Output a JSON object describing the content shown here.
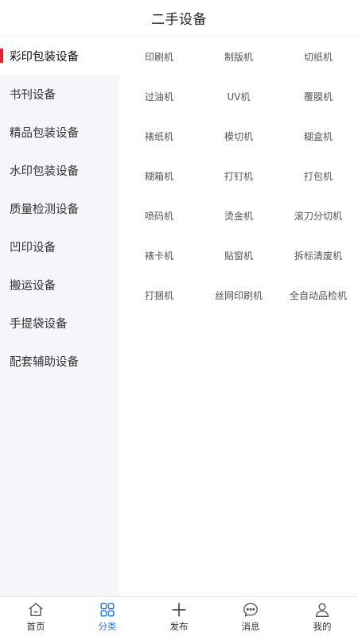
{
  "header": {
    "title": "二手设备"
  },
  "sidebar": {
    "active_index": 0,
    "items": [
      {
        "label": "彩印包装设备"
      },
      {
        "label": "书刊设备"
      },
      {
        "label": "精品包装设备"
      },
      {
        "label": "水印包装设备"
      },
      {
        "label": "质量检测设备"
      },
      {
        "label": "凹印设备"
      },
      {
        "label": "搬运设备"
      },
      {
        "label": "手提袋设备"
      },
      {
        "label": "配套辅助设备"
      }
    ]
  },
  "grid": {
    "items": [
      "印刷机",
      "制版机",
      "切纸机",
      "过油机",
      "UV机",
      "覆膜机",
      "裱纸机",
      "模切机",
      "糊盒机",
      "糊箱机",
      "打钉机",
      "打包机",
      "喷码机",
      "烫金机",
      "滚刀分切机",
      "裱卡机",
      "贴窗机",
      "拆标清废机",
      "打捆机",
      "丝网印刷机",
      "全自动品检机"
    ]
  },
  "tabbar": {
    "active_index": 1,
    "accent": "#2b7de9",
    "items": [
      {
        "label": "首页",
        "icon": "home-icon"
      },
      {
        "label": "分类",
        "icon": "category-grid-icon"
      },
      {
        "label": "发布",
        "icon": "plus-icon"
      },
      {
        "label": "消息",
        "icon": "message-bubble-icon"
      },
      {
        "label": "我的",
        "icon": "user-icon"
      }
    ]
  }
}
